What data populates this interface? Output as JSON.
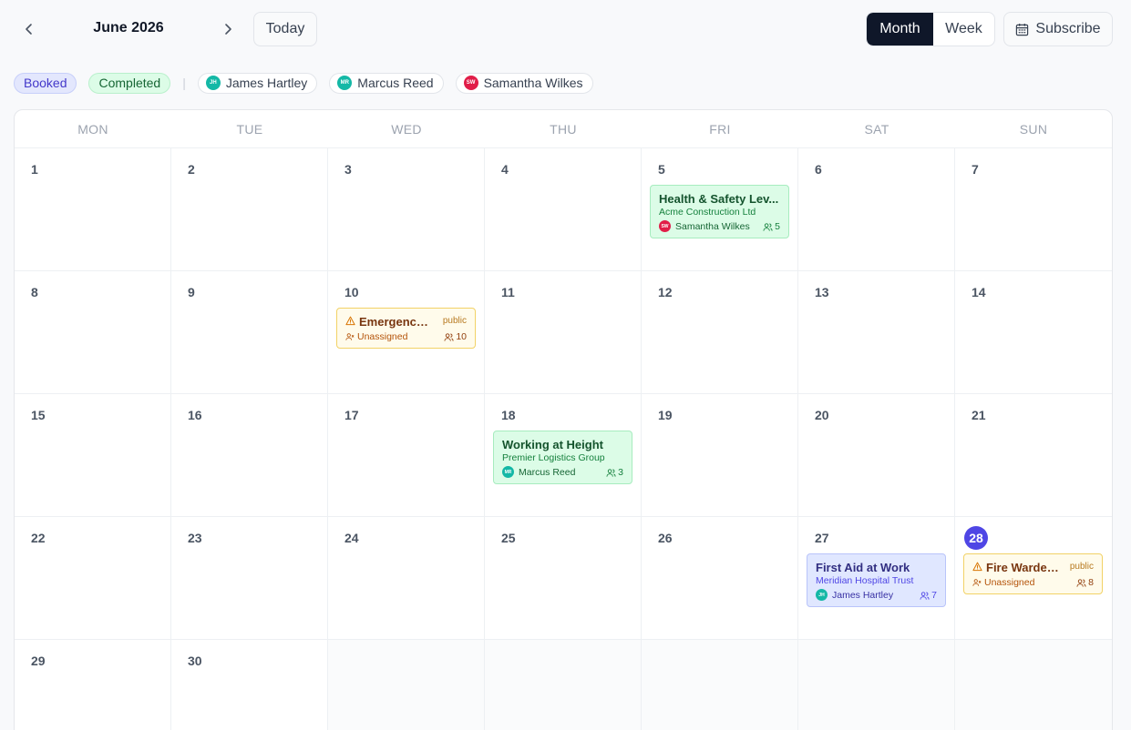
{
  "header": {
    "month_title": "June 2026",
    "today_label": "Today",
    "view_month": "Month",
    "view_week": "Week",
    "subscribe_label": "Subscribe",
    "active_view": "Month"
  },
  "filters": {
    "status": [
      {
        "label": "Booked",
        "color": "#e3e7fd"
      },
      {
        "label": "Completed",
        "color": "#dcfce7"
      }
    ],
    "separator": "|",
    "trainers": [
      {
        "initials": "JH",
        "name": "James Hartley",
        "avatar_color": "#14b8a6"
      },
      {
        "initials": "MR",
        "name": "Marcus Reed",
        "avatar_color": "#14b8a6"
      },
      {
        "initials": "SW",
        "name": "Samantha Wilkes",
        "avatar_color": "#e11d48"
      }
    ]
  },
  "calendar": {
    "weekdays": [
      "MON",
      "TUE",
      "WED",
      "THU",
      "FRI",
      "SAT",
      "SUN"
    ],
    "today": "28",
    "days": [
      "1",
      "2",
      "3",
      "4",
      "5",
      "6",
      "7",
      "8",
      "9",
      "10",
      "11",
      "12",
      "13",
      "14",
      "15",
      "16",
      "17",
      "18",
      "19",
      "20",
      "21",
      "22",
      "23",
      "24",
      "25",
      "26",
      "27",
      "28",
      "29",
      "30"
    ],
    "events": {
      "e5": {
        "day": "5",
        "status": "Completed",
        "title": "Health & Safety Lev...",
        "client": "Acme Construction Ltd",
        "trainer_initials": "SW",
        "trainer": "Samantha Wilkes",
        "attendees": "5"
      },
      "e10": {
        "day": "10",
        "status": "Unassigned",
        "title": "Emergency ...",
        "visibility": "public",
        "trainer": "Unassigned",
        "attendees": "10"
      },
      "e18": {
        "day": "18",
        "status": "Completed",
        "title": "Working at Height",
        "client": "Premier Logistics Group",
        "trainer_initials": "MR",
        "trainer": "Marcus Reed",
        "attendees": "3"
      },
      "e27": {
        "day": "27",
        "status": "Booked",
        "title": "First Aid at Work",
        "client": "Meridian Hospital Trust",
        "trainer_initials": "JH",
        "trainer": "James Hartley",
        "attendees": "7"
      },
      "e28": {
        "day": "28",
        "status": "Unassigned",
        "title": "Fire Warden...",
        "visibility": "public",
        "trainer": "Unassigned",
        "attendees": "8"
      }
    }
  },
  "colors": {
    "accent": "#4f46e5",
    "active_toggle": "#0f1729",
    "completed_bg": "#dcfce7",
    "booked_bg": "#e0e7ff",
    "unassigned_bg": "#fffbeb"
  }
}
